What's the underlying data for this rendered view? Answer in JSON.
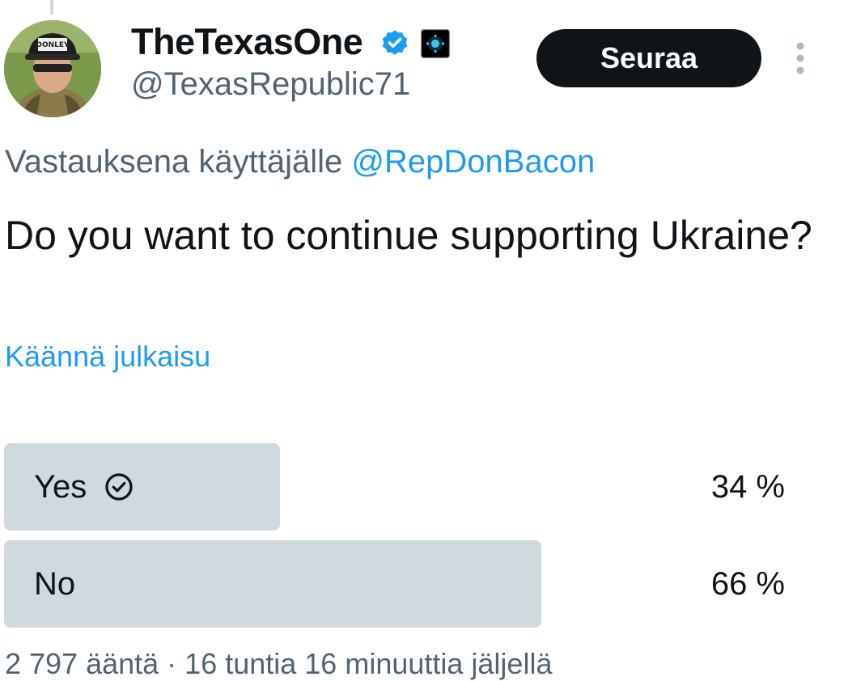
{
  "author": {
    "display_name": "TheTexasOne",
    "handle": "@TexasRepublic71",
    "avatar_icon": "profile-photo",
    "verified_icon": "verified-badge-icon",
    "affiliate_icon": "affiliate-badge-icon",
    "hat_text": "DONLEY"
  },
  "follow_button": {
    "label": "Seuraa"
  },
  "more_icon": "more-vertical-icon",
  "reply_context": {
    "prefix": "Vastauksena käyttäjälle ",
    "mention": "@RepDonBacon"
  },
  "tweet_text": "Do you want to continue supporting Ukraine?",
  "translate_link": "Käännä julkaisu",
  "poll": {
    "options": [
      {
        "label": "Yes",
        "percent_text": "34 %",
        "percent": 34,
        "selected": true
      },
      {
        "label": "No",
        "percent_text": "66 %",
        "percent": 66,
        "selected": false
      }
    ],
    "meta": "2 797 ääntä · 16 tuntia 16 minuuttia jäljellä"
  },
  "colors": {
    "accent": "#1d9bf0",
    "text_primary": "#0f1419",
    "text_secondary": "#536471",
    "poll_bar": "#cfd9de",
    "button_bg": "#0f1419"
  }
}
